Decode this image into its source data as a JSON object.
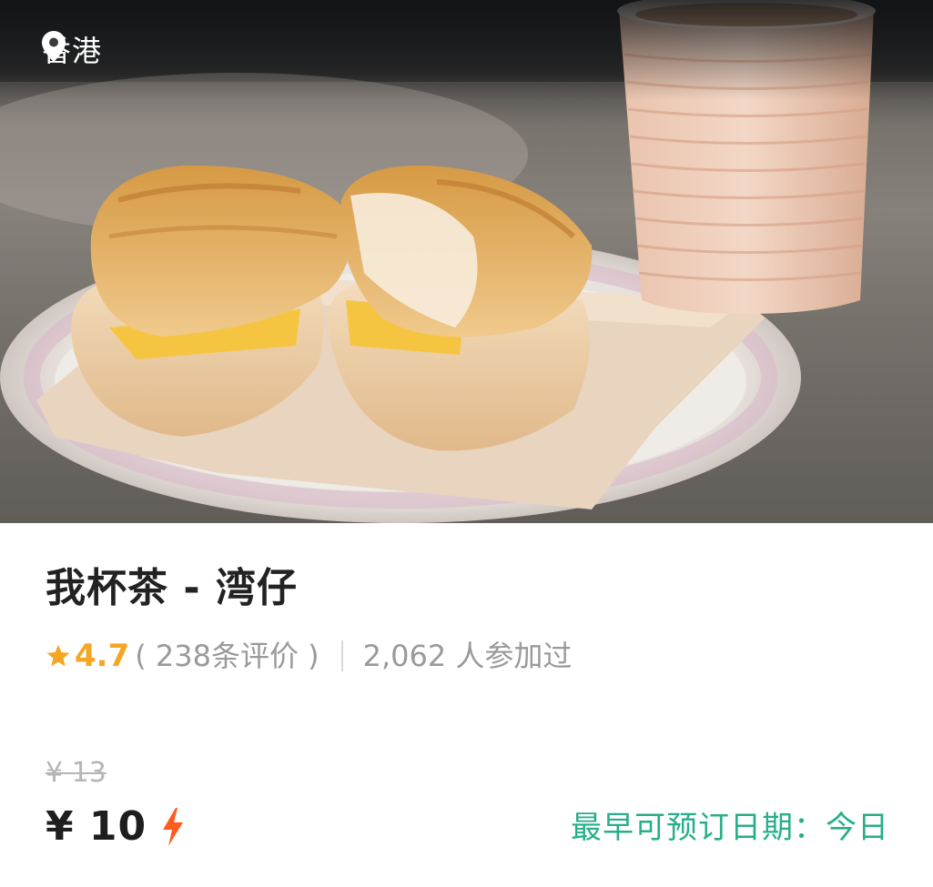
{
  "photo": {
    "location": "香港",
    "location_icon": "map-pin-icon",
    "alt_description_icon": "food-photo"
  },
  "product": {
    "title": "我杯茶 - 湾仔",
    "rating": "4.7",
    "review_count": "( 238条评价 )",
    "participants": "2,062 人参加过",
    "original_price": "¥ 13",
    "current_price": "¥ 10",
    "instant_icon": "lightning-bolt-icon",
    "booking_date": "最早可预订日期：今日"
  },
  "colors": {
    "rating_star": "#f5a623",
    "bolt": "#ff5a1f",
    "booking_text": "#27ae8a",
    "title_text": "#222222",
    "muted_text": "#9a9a9a"
  }
}
